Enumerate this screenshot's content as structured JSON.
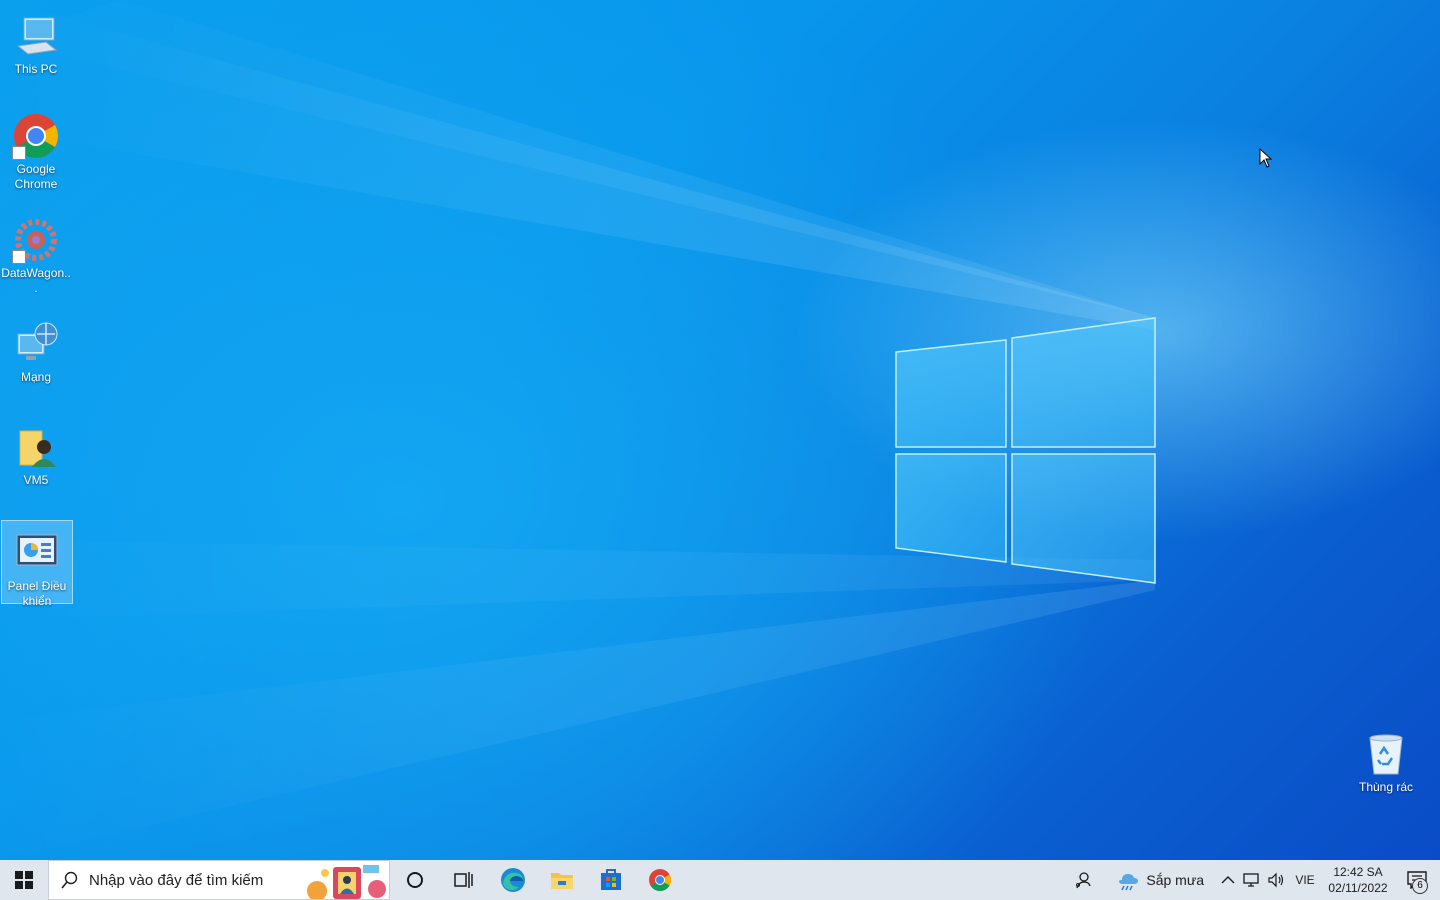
{
  "desktop": {
    "icons": [
      {
        "label": "This PC",
        "icon": "this-pc-icon"
      },
      {
        "label": "Google Chrome",
        "icon": "chrome-icon"
      },
      {
        "label": "DataWagon...",
        "icon": "datawagon-icon"
      },
      {
        "label": "Mạng",
        "icon": "network-icon"
      },
      {
        "label": "VM5",
        "icon": "user-folder-icon"
      },
      {
        "label": "Panel Điều khiển",
        "icon": "control-panel-icon",
        "selected": true
      },
      {
        "label": "Thùng rác",
        "icon": "recycle-bin-icon"
      }
    ]
  },
  "taskbar": {
    "search_placeholder": "Nhập vào đây để tìm kiếm",
    "apps": [
      "cortana-icon",
      "task-view-icon",
      "edge-icon",
      "file-explorer-icon",
      "store-icon",
      "chrome-icon"
    ],
    "weather_text": "Sắp mưa",
    "language": "VIE",
    "time": "12:42 SA",
    "date": "02/11/2022",
    "notification_count": "6"
  },
  "colors": {
    "accent": "#0a8fe8",
    "taskbar_bg": "#dfe6ee",
    "desktop_text": "#ffffff"
  }
}
